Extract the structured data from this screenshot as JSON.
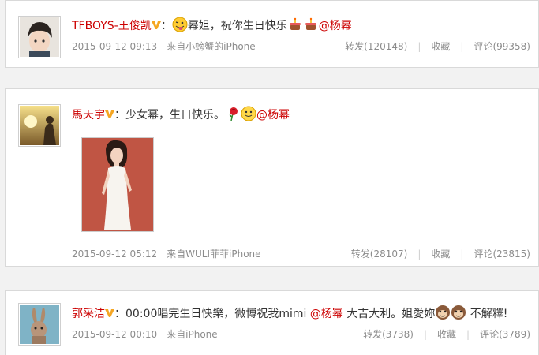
{
  "posts": [
    {
      "author": "TFBOYS-王俊凯",
      "colon": "：",
      "text_a": "幂姐，祝你生日快乐",
      "mention": "@杨幂",
      "time": "2015-09-12 09:13",
      "source": "来自小螃蟹的iPhone",
      "repost": "转发(120148)",
      "favorite": "收藏",
      "comment": "评论(99358)"
    },
    {
      "author": "馬天宇",
      "colon": "：",
      "text_a": "少女幂，生日快乐。",
      "mention": "@杨幂",
      "time": "2015-09-12 05:12",
      "source": "来自WULI菲菲iPhone",
      "repost": "转发(28107)",
      "favorite": "收藏",
      "comment": "评论(23815)"
    },
    {
      "author": "郭采洁",
      "colon": "：",
      "text_a": "00:00唱完生日快樂，微博祝我mimi ",
      "mention": "@杨幂",
      "text_b": " 大吉大利。姐愛妳",
      "text_c": " 不解釋!",
      "time": "2015-09-12 00:10",
      "source": "来自iPhone",
      "repost": "转发(3738)",
      "favorite": "收藏",
      "comment": "评论(3789)"
    }
  ],
  "colors": {
    "author": "#cc0000",
    "meta": "#8c8c8c",
    "badge": "#f5a623"
  }
}
